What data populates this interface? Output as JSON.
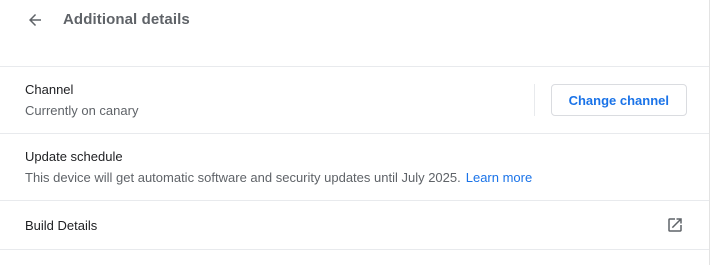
{
  "header": {
    "title": "Additional details",
    "back_icon": "arrow-back-icon"
  },
  "channel": {
    "label": "Channel",
    "status": "Currently on canary",
    "button_label": "Change channel"
  },
  "update_schedule": {
    "label": "Update schedule",
    "description": "This device will get automatic software and security updates until July 2025.",
    "link_label": "Learn more"
  },
  "build_details": {
    "label": "Build Details",
    "icon": "open-in-new-icon"
  },
  "colors": {
    "accent": "#1a73e8",
    "text_primary": "#202124",
    "text_secondary": "#5f6368",
    "divider": "#e8eaed"
  }
}
